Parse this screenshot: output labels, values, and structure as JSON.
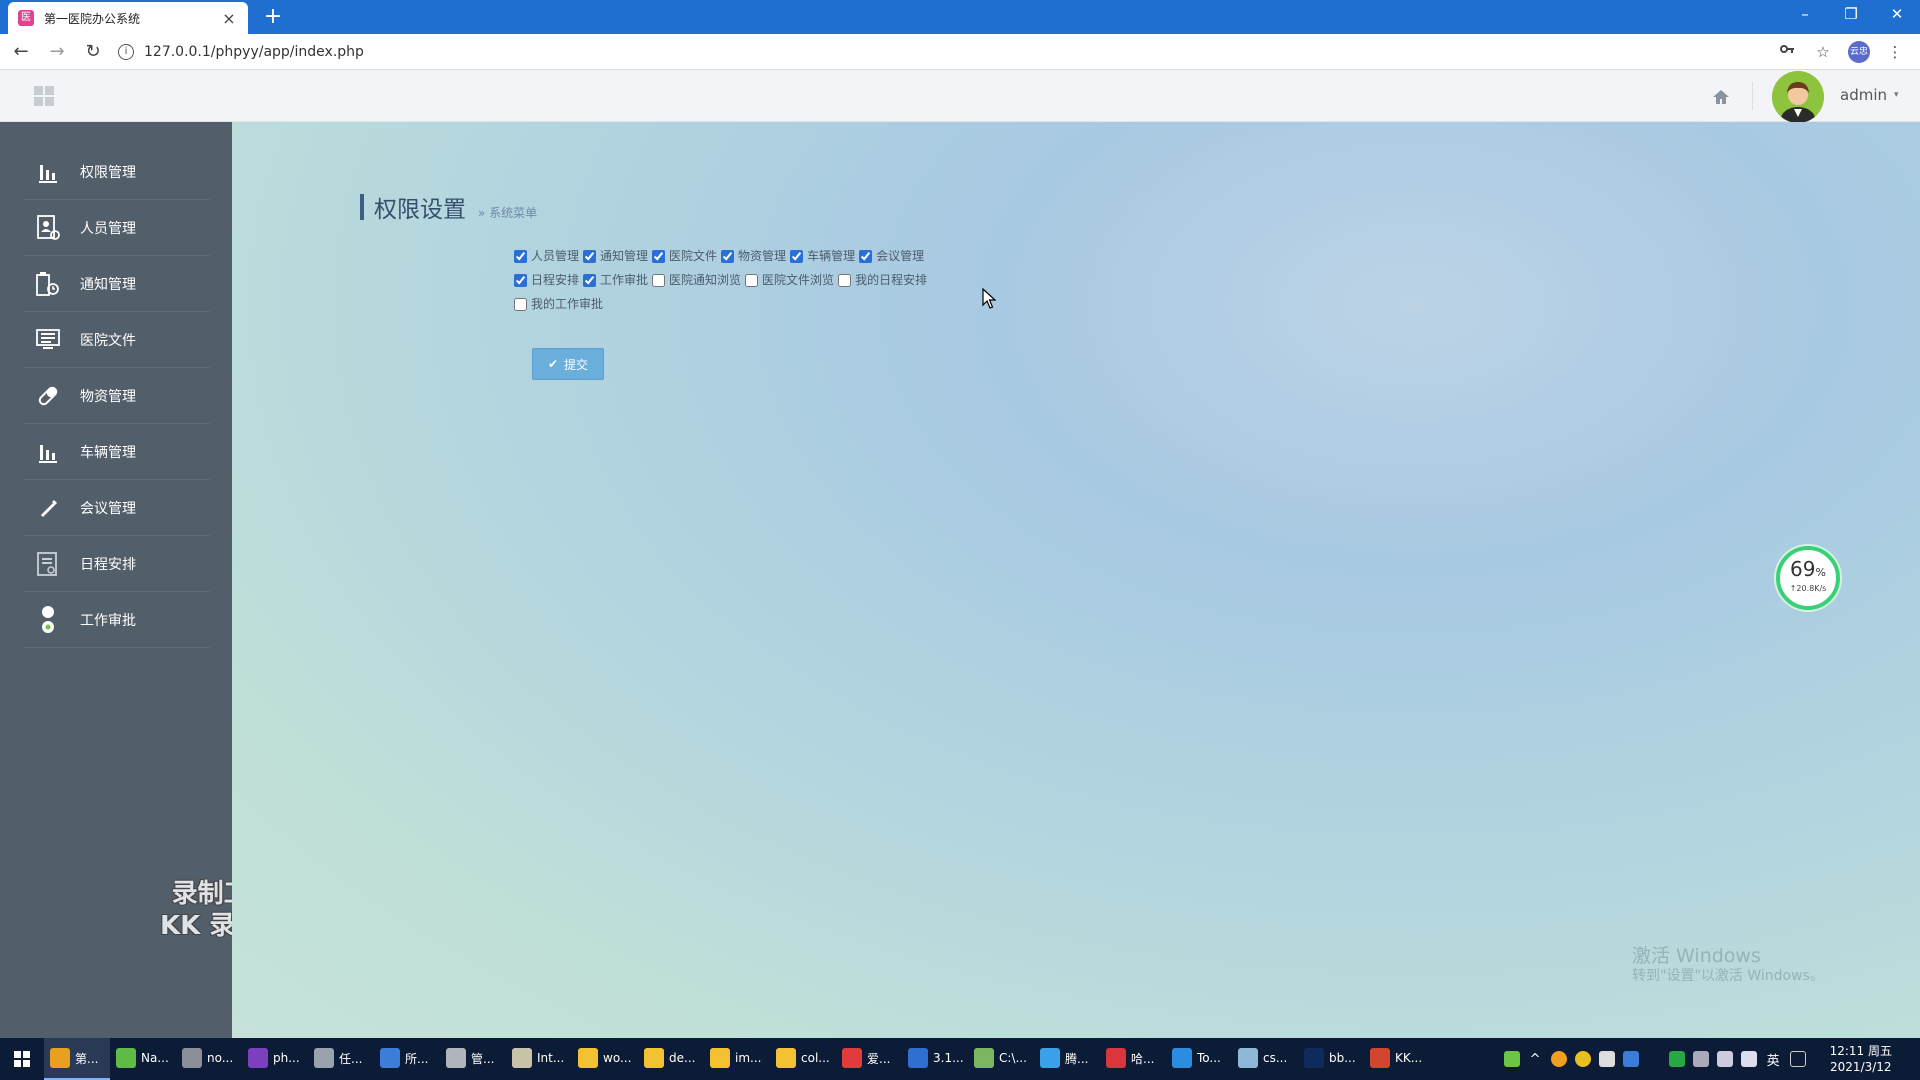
{
  "browser": {
    "tab_title": "第一医院办公系统",
    "tab_favicon": "医",
    "new_tab_label": "+",
    "minimize": "–",
    "maximize": "❐",
    "close": "✕",
    "url": "127.0.0.1/phpyy/app/index.php",
    "profile_label": "云忠"
  },
  "header": {
    "user_name": "admin",
    "caret": "▾"
  },
  "sidebar": {
    "items": [
      {
        "label": "权限管理",
        "icon": "bar-chart-icon"
      },
      {
        "label": "人员管理",
        "icon": "user-doc-icon"
      },
      {
        "label": "通知管理",
        "icon": "notice-icon"
      },
      {
        "label": "医院文件",
        "icon": "monitor-icon"
      },
      {
        "label": "物资管理",
        "icon": "pill-icon"
      },
      {
        "label": "车辆管理",
        "icon": "bar-chart-icon"
      },
      {
        "label": "会议管理",
        "icon": "pen-icon"
      },
      {
        "label": "日程安排",
        "icon": "calendar-doc-icon"
      },
      {
        "label": "工作审批",
        "icon": "approval-icon"
      }
    ],
    "watermark_line1": "录制工具",
    "watermark_line2": "KK 录像机"
  },
  "main": {
    "page_title": "权限设置",
    "breadcrumb": "» 系统菜单",
    "permissions": [
      {
        "label": "人员管理",
        "checked": true
      },
      {
        "label": "通知管理",
        "checked": true
      },
      {
        "label": "医院文件",
        "checked": true
      },
      {
        "label": "物资管理",
        "checked": true
      },
      {
        "label": "车辆管理",
        "checked": true
      },
      {
        "label": "会议管理",
        "checked": true
      },
      {
        "label": "日程安排",
        "checked": true
      },
      {
        "label": "工作审批",
        "checked": true
      },
      {
        "label": "医院通知浏览",
        "checked": false
      },
      {
        "label": "医院文件浏览",
        "checked": false
      },
      {
        "label": "我的日程安排",
        "checked": false
      },
      {
        "label": "我的工作审批",
        "checked": false
      }
    ],
    "submit_label": "提交",
    "speed_percent": "69",
    "speed_percent_unit": "%",
    "speed_rate": "↑20.8K/s",
    "activate_line1": "激活 Windows",
    "activate_line2": "转到\"设置\"以激活 Windows。"
  },
  "taskbar": {
    "apps": [
      {
        "label": "第...",
        "color": "#e9a020",
        "active": true
      },
      {
        "label": "Na...",
        "color": "#5dbb46",
        "active": false
      },
      {
        "label": "no...",
        "color": "#8b8f99",
        "active": false
      },
      {
        "label": "ph...",
        "color": "#7b3fbf",
        "active": false
      },
      {
        "label": "任...",
        "color": "#9aa3ad",
        "active": false
      },
      {
        "label": "所...",
        "color": "#3b7dd8",
        "active": false
      },
      {
        "label": "管...",
        "color": "#b0b5bb",
        "active": false
      },
      {
        "label": "Int...",
        "color": "#c8c2a8",
        "active": false
      },
      {
        "label": "wo...",
        "color": "#f2c232",
        "active": false
      },
      {
        "label": "de...",
        "color": "#f2c232",
        "active": false
      },
      {
        "label": "im...",
        "color": "#f2c232",
        "active": false
      },
      {
        "label": "col...",
        "color": "#f2c232",
        "active": false
      },
      {
        "label": "爱...",
        "color": "#e23b3b",
        "active": false
      },
      {
        "label": "3.1...",
        "color": "#2f6fcf",
        "active": false
      },
      {
        "label": "C:\\...",
        "color": "#7bb661",
        "active": false
      },
      {
        "label": "腾...",
        "color": "#3aa0e8",
        "active": false
      },
      {
        "label": "哈...",
        "color": "#d9363e",
        "active": false
      },
      {
        "label": "To...",
        "color": "#2a8de0",
        "active": false
      },
      {
        "label": "cs...",
        "color": "#8fb7d6",
        "active": false
      },
      {
        "label": "bb...",
        "color": "#0f2a5c",
        "active": false
      },
      {
        "label": "KK...",
        "color": "#d2452f",
        "active": false
      }
    ],
    "ime": "英",
    "time": "12:11 周五",
    "date": "2021/3/12"
  }
}
